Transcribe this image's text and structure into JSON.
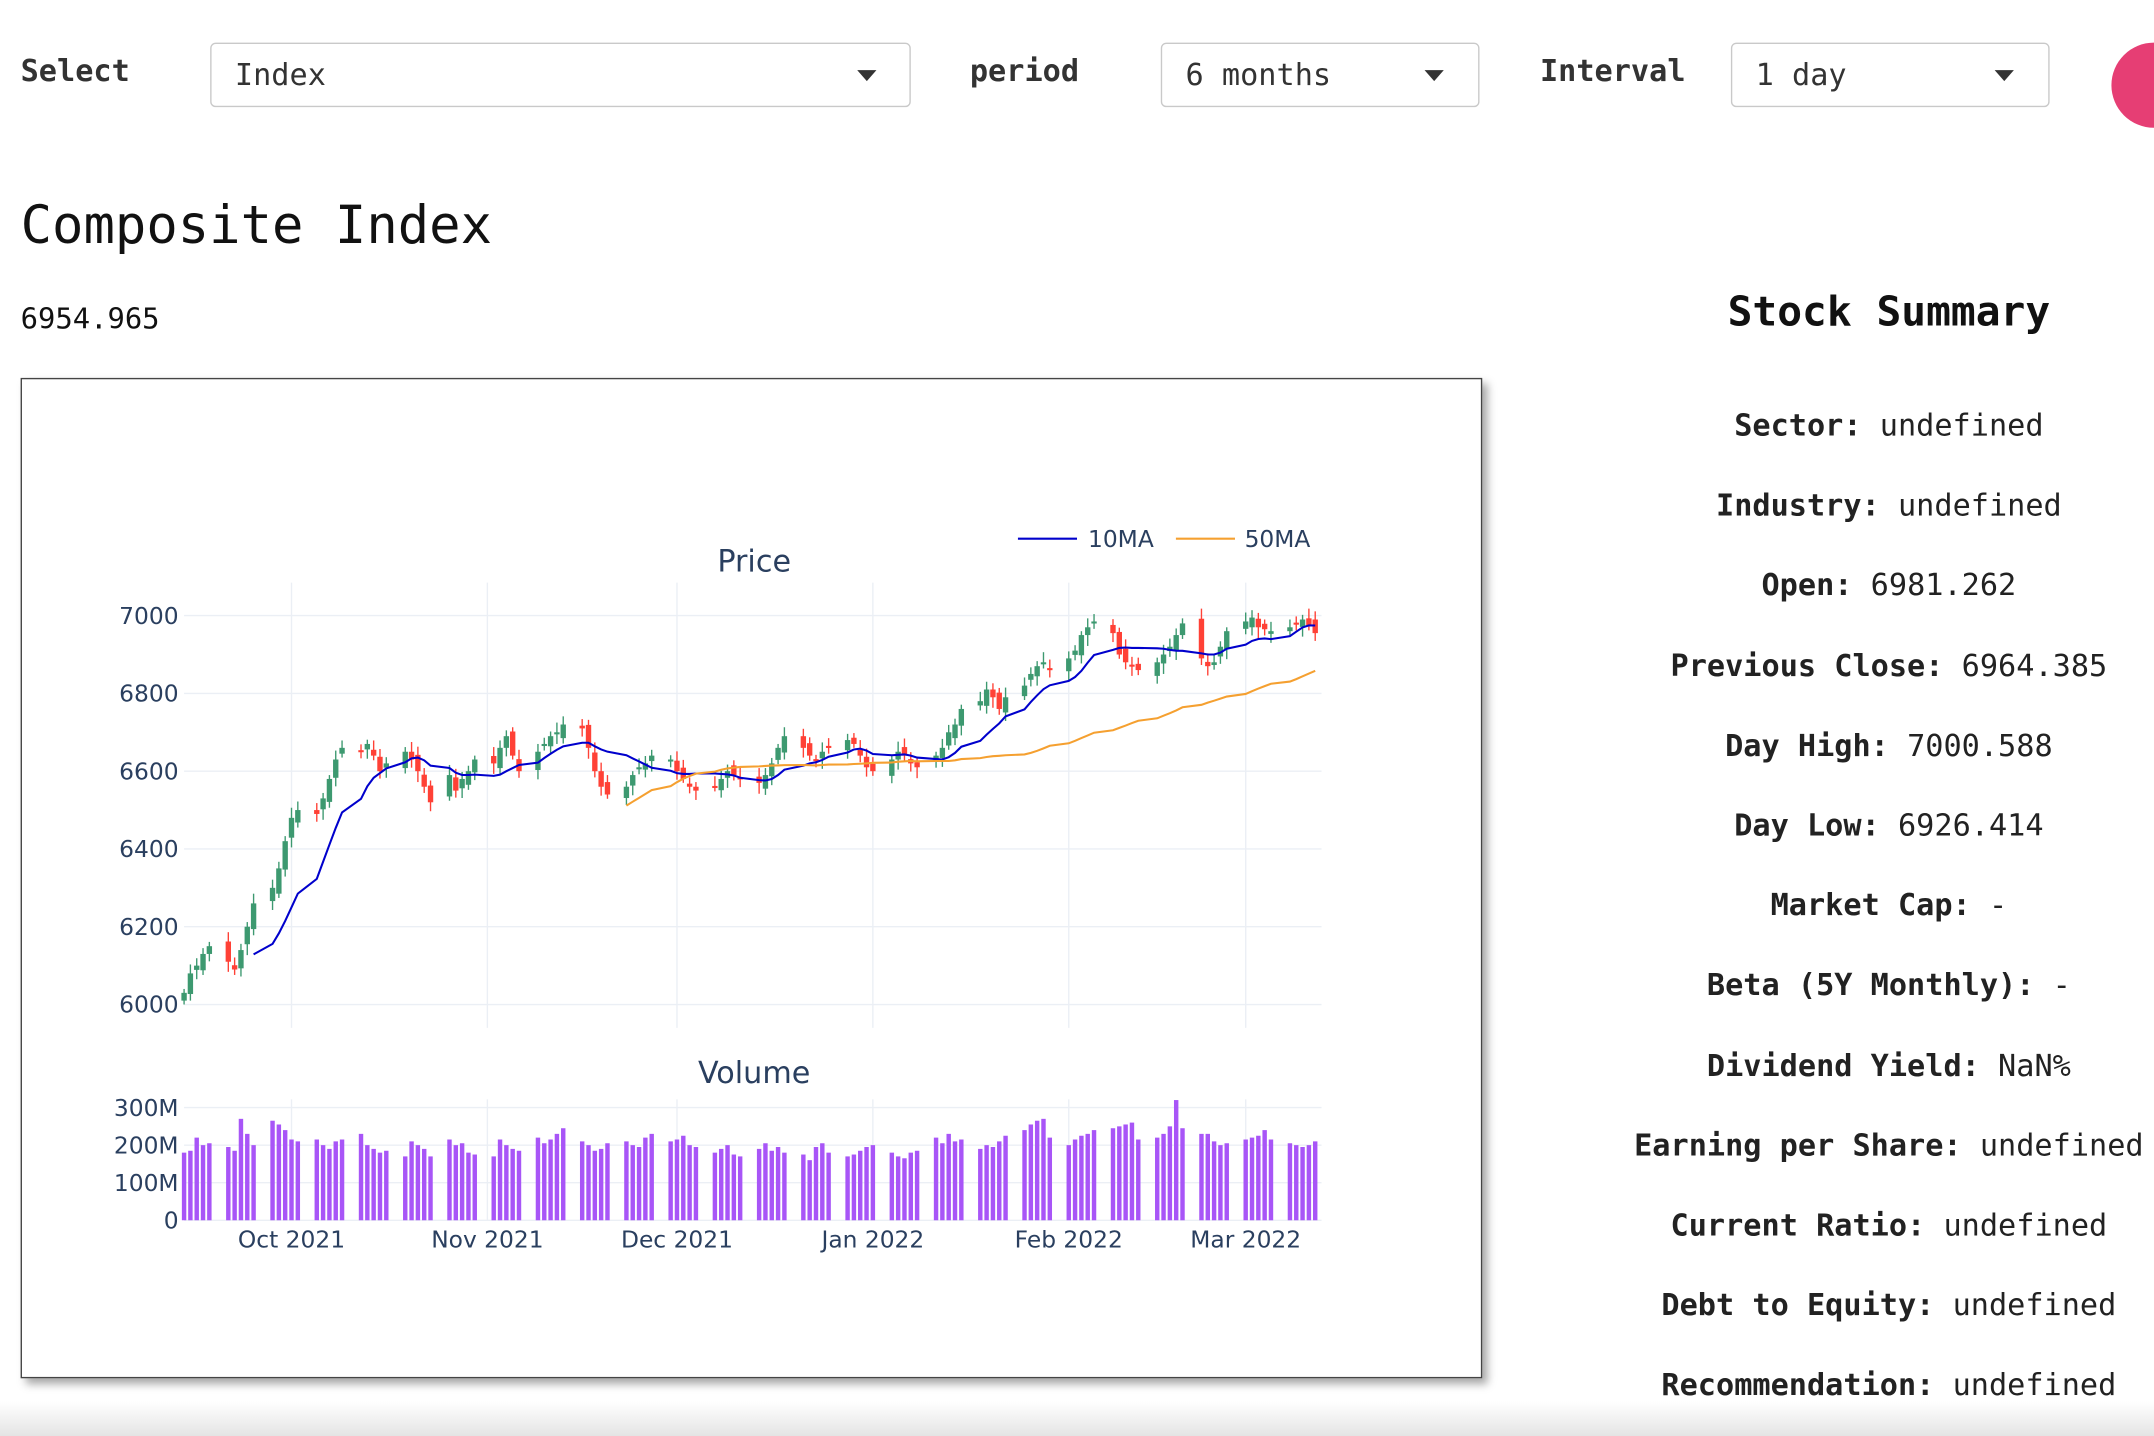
{
  "controls": {
    "select_label": "Select",
    "select_value": "Index",
    "period_label": "period",
    "period_value": "6 months",
    "interval_label": "Interval",
    "interval_value": "1 day",
    "accent_color": "#e63e74"
  },
  "header": {
    "title": "Composite Index",
    "last_price": "6954.965"
  },
  "summary": {
    "title": "Stock Summary",
    "rows": [
      {
        "label": "Sector:",
        "value": "undefined"
      },
      {
        "label": "Industry:",
        "value": "undefined"
      },
      {
        "label": "Open:",
        "value": "6981.262"
      },
      {
        "label": "Previous Close:",
        "value": "6964.385"
      },
      {
        "label": "Day High:",
        "value": "7000.588"
      },
      {
        "label": "Day Low:",
        "value": "6926.414"
      },
      {
        "label": "Market Cap:",
        "value": "-"
      },
      {
        "label": "Beta (5Y Monthly):",
        "value": "-"
      },
      {
        "label": "Dividend Yield:",
        "value": "NaN%"
      },
      {
        "label": "Earning per Share:",
        "value": "undefined"
      },
      {
        "label": "Current Ratio:",
        "value": "undefined"
      },
      {
        "label": "Debt to Equity:",
        "value": "undefined"
      },
      {
        "label": "Recommendation:",
        "value": "undefined"
      }
    ]
  },
  "chart_data": [
    {
      "type": "line",
      "title": "Price",
      "candlestick": true,
      "x_ticks": [
        "Oct 2021",
        "Nov 2021",
        "Dec 2021",
        "Jan 2022",
        "Feb 2022",
        "Mar 2022"
      ],
      "x_tick_days": [
        17,
        48,
        78,
        109,
        140,
        168
      ],
      "x_day_range": [
        0,
        180
      ],
      "ylim": [
        6000,
        7000
      ],
      "y_ticks": [
        6000,
        6200,
        6400,
        6600,
        6800,
        7000
      ],
      "legend": [
        "10MA",
        "50MA"
      ],
      "legend_position": "top-right",
      "up_color": "#3d9970",
      "down_color": "#ff4136",
      "ma10_color": "#0000cc",
      "ma50_color": "#f5a030",
      "grid": true,
      "candle_days": [
        0,
        1,
        2,
        3,
        4,
        7,
        8,
        9,
        10,
        11,
        14,
        15,
        16,
        17,
        18,
        21,
        22,
        23,
        24,
        25,
        28,
        29,
        30,
        31,
        32,
        35,
        36,
        37,
        38,
        39,
        42,
        43,
        44,
        45,
        46,
        49,
        50,
        51,
        52,
        53,
        56,
        57,
        58,
        59,
        60,
        63,
        64,
        65,
        66,
        67,
        70,
        71,
        72,
        73,
        74,
        77,
        78,
        79,
        80,
        81,
        84,
        85,
        86,
        87,
        88,
        91,
        92,
        93,
        94,
        95,
        98,
        99,
        100,
        101,
        102,
        105,
        106,
        107,
        108,
        109,
        112,
        113,
        114,
        115,
        116,
        119,
        120,
        121,
        122,
        123,
        126,
        127,
        128,
        129,
        130,
        133,
        134,
        135,
        136,
        137,
        140,
        141,
        142,
        143,
        144,
        147,
        148,
        149,
        150,
        151,
        154,
        155,
        156,
        157,
        158,
        161,
        162,
        163,
        164,
        165,
        168,
        169,
        170,
        171,
        172,
        175,
        176,
        177,
        178,
        179
      ],
      "close": [
        6030,
        6080,
        6100,
        6130,
        6150,
        6110,
        6090,
        6140,
        6200,
        6260,
        6300,
        6350,
        6420,
        6480,
        6500,
        6490,
        6530,
        6580,
        6630,
        6660,
        6650,
        6670,
        6640,
        6600,
        6620,
        6650,
        6630,
        6600,
        6560,
        6520,
        6590,
        6550,
        6580,
        6600,
        6630,
        6620,
        6660,
        6690,
        6640,
        6600,
        6650,
        6670,
        6690,
        6700,
        6720,
        6710,
        6660,
        6600,
        6560,
        6540,
        6560,
        6590,
        6610,
        6620,
        6640,
        6630,
        6600,
        6580,
        6560,
        6550,
        6560,
        6580,
        6600,
        6590,
        6580,
        6570,
        6590,
        6620,
        6660,
        6690,
        6660,
        6640,
        6630,
        6650,
        6660,
        6680,
        6670,
        6640,
        6610,
        6600,
        6630,
        6650,
        6640,
        6620,
        6610,
        6640,
        6660,
        6700,
        6720,
        6760,
        6780,
        6810,
        6790,
        6760,
        6790,
        6820,
        6850,
        6870,
        6880,
        6860,
        6890,
        6910,
        6950,
        6970,
        6985,
        6955,
        6900,
        6880,
        6870,
        6860,
        6880,
        6900,
        6920,
        6950,
        6980,
        6890,
        6870,
        6880,
        6920,
        6960,
        6985,
        6995,
        6970,
        6965,
        6960,
        6970,
        6980,
        6990,
        6975,
        6955
      ],
      "volume_m": [
        180,
        185,
        220,
        200,
        205,
        195,
        185,
        270,
        230,
        200,
        265,
        255,
        240,
        215,
        210,
        215,
        200,
        190,
        210,
        215,
        230,
        200,
        190,
        180,
        185,
        170,
        210,
        200,
        190,
        170,
        215,
        200,
        205,
        180,
        175,
        170,
        215,
        200,
        190,
        185,
        220,
        205,
        215,
        230,
        245,
        210,
        200,
        185,
        190,
        205,
        210,
        200,
        195,
        220,
        230,
        210,
        215,
        225,
        200,
        195,
        180,
        190,
        200,
        175,
        170,
        190,
        205,
        185,
        195,
        180,
        175,
        160,
        195,
        205,
        180,
        170,
        175,
        185,
        195,
        200,
        180,
        170,
        165,
        180,
        185,
        220,
        205,
        230,
        210,
        215,
        190,
        200,
        195,
        210,
        225,
        240,
        255,
        265,
        270,
        220,
        200,
        215,
        225,
        230,
        240,
        245,
        250,
        255,
        260,
        215,
        220,
        230,
        250,
        320,
        245,
        230,
        230,
        210,
        200,
        205,
        215,
        220,
        225,
        240,
        215,
        205,
        200,
        195,
        200,
        210
      ]
    },
    {
      "type": "bar",
      "title": "Volume",
      "ylim": [
        0,
        300
      ],
      "y_ticks": [
        "0",
        "100M",
        "200M",
        "300M"
      ],
      "bar_color": "#a855f7",
      "grid": true
    }
  ]
}
